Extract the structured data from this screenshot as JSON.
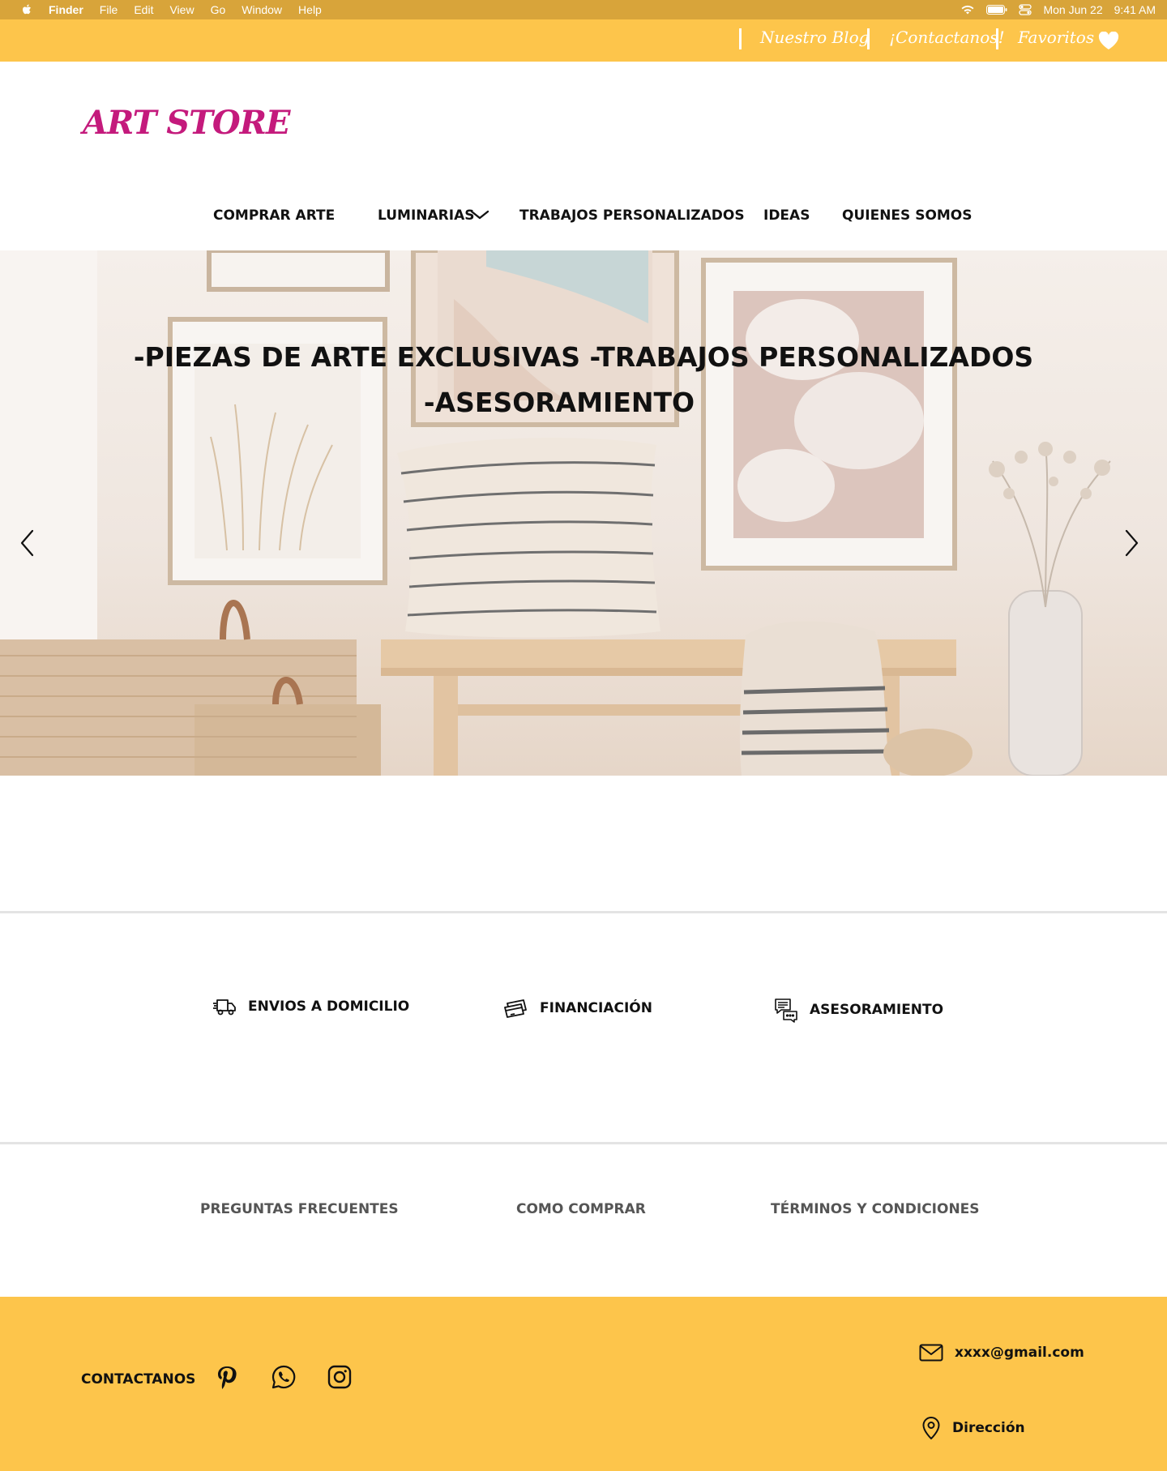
{
  "mac_menu": {
    "app": "Finder",
    "items": [
      "File",
      "Edit",
      "View",
      "Go",
      "Window",
      "Help"
    ],
    "date": "Mon Jun 22",
    "time": "9:41 AM"
  },
  "top_links": {
    "blog": "Nuestro Blog",
    "contact": "¡Contactanos!",
    "favorites": "Favoritos"
  },
  "brand": {
    "logo": "ART STORE"
  },
  "nav": {
    "comprar": "COMPRAR ARTE",
    "luminarias": "LUMINARIAS",
    "trabajos": "TRABAJOS PERSONALIZADOS",
    "ideas": "IDEAS",
    "quienes": "QUIENES SOMOS"
  },
  "hero": {
    "line1": "-PIEZAS DE ARTE EXCLUSIVAS   -TRABAJOS PERSONALIZADOS",
    "line2": "-ASESORAMIENTO"
  },
  "features": {
    "envios": "ENVIOS A  DOMICILIO",
    "financiacion": "FINANCIACIÓN",
    "asesoramiento": "ASESORAMIENTO"
  },
  "info_links": {
    "faq": "PREGUNTAS FRECUENTES",
    "como": "COMO COMPRAR",
    "terminos": "TÉRMINOS Y CONDICIONES"
  },
  "footer": {
    "contact_label": "CONTACTANOS",
    "email": "xxxx@gmail.com",
    "address": "Dirección"
  },
  "colors": {
    "accent_yellow": "#fdc54b",
    "menubar": "#d8a43a",
    "logo_magenta": "#c41a7c"
  },
  "icons": [
    "apple-icon",
    "wifi-icon",
    "battery-icon",
    "control-center-icon",
    "heart-icon",
    "chevron-down-icon",
    "arrow-left-icon",
    "arrow-right-icon",
    "truck-icon",
    "credit-card-icon",
    "chat-icon",
    "pinterest-icon",
    "whatsapp-icon",
    "instagram-icon",
    "mail-icon",
    "location-pin-icon"
  ]
}
